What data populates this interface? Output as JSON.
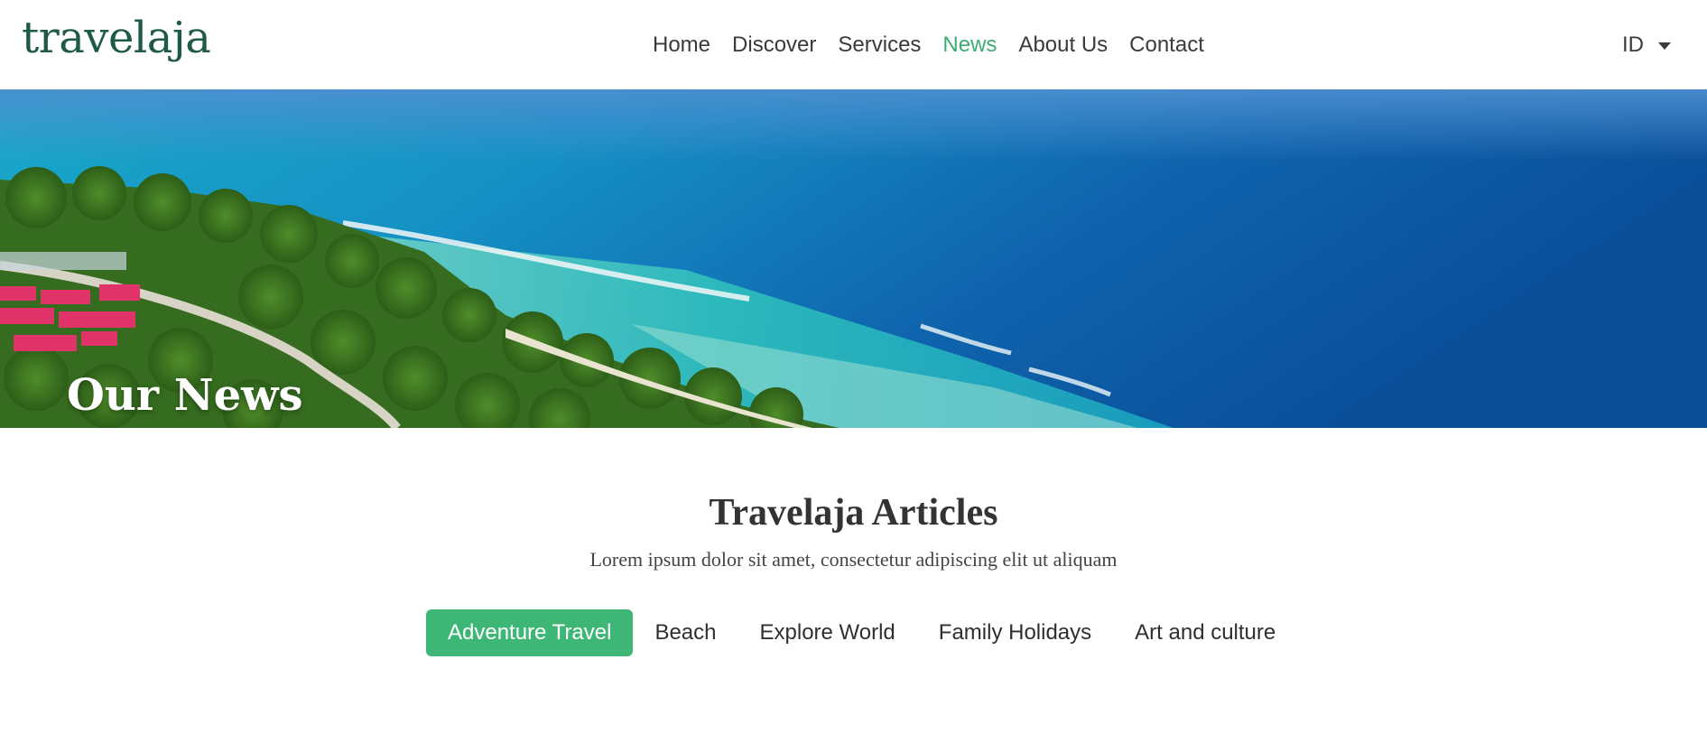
{
  "brand": {
    "name": "travelaja",
    "color": "#1f5a45"
  },
  "nav": {
    "items": [
      {
        "label": "Home"
      },
      {
        "label": "Discover"
      },
      {
        "label": "Services"
      },
      {
        "label": "News"
      },
      {
        "label": "About Us"
      },
      {
        "label": "Contact"
      }
    ],
    "active": "News",
    "active_color": "#3eab72"
  },
  "language": {
    "label": "ID",
    "icon": "caret-down-icon"
  },
  "hero": {
    "title": "Our News"
  },
  "articles": {
    "title": "Travelaja Articles",
    "subtitle": "Lorem ipsum dolor sit amet, consectetur adipiscing elit ut aliquam",
    "tabs": [
      {
        "label": "Adventure Travel"
      },
      {
        "label": "Beach"
      },
      {
        "label": "Explore World"
      },
      {
        "label": "Family Holidays"
      },
      {
        "label": "Art and culture"
      }
    ],
    "active_tab": "Adventure Travel",
    "active_tab_color": "#3eb776"
  }
}
